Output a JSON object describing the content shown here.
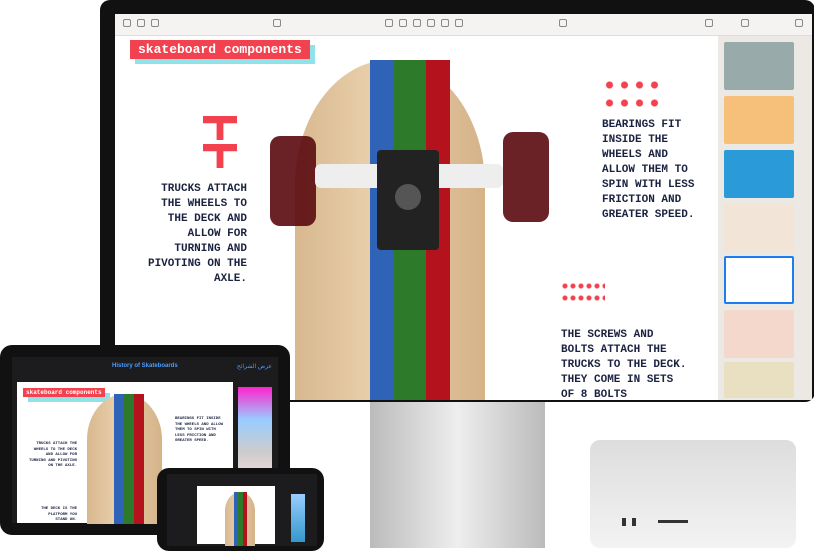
{
  "keynote": {
    "slide_title": "skateboard components",
    "trucks_text": "TRUCKS ATTACH THE WHEELS TO THE DECK AND ALLOW FOR TURNING AND PIVOTING ON THE AXLE.",
    "bearings_text": "BEARINGS FIT INSIDE THE WHEELS AND ALLOW THEM TO SPIN WITH LESS FRICTION AND GREATER SPEED.",
    "screws_text": "THE SCREWS AND BOLTS ATTACH THE TRUCKS TO THE DECK. THEY COME IN SETS OF 8 BOLTS",
    "deck_text": "THE DECK IS THE PLATFORM YOU STAND ON."
  },
  "ipad": {
    "document_title": "History of Skateboards",
    "slideshow_label": "عرض الشرائح"
  },
  "colors": {
    "accent": "#f2414f",
    "text": "#1b2240",
    "blue": "#2f63b8",
    "green": "#2d7a2a",
    "red": "#b4121c"
  }
}
